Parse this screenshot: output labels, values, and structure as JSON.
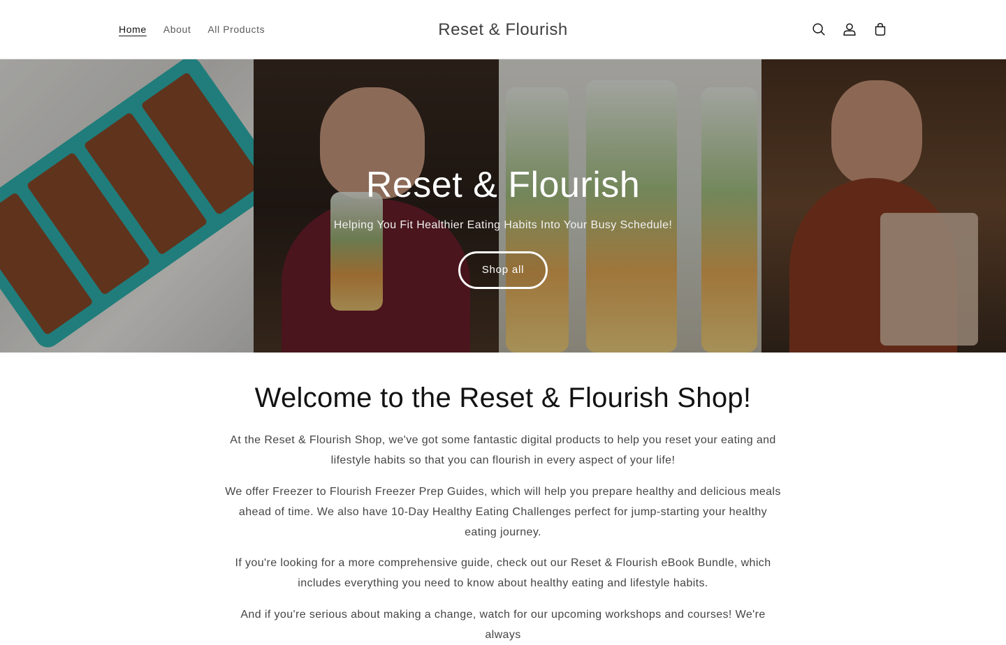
{
  "header": {
    "nav": [
      {
        "label": "Home",
        "active": true
      },
      {
        "label": "About",
        "active": false
      },
      {
        "label": "All Products",
        "active": false
      }
    ],
    "logo": "Reset & Flourish",
    "icons": [
      "search-icon",
      "account-icon",
      "cart-icon"
    ]
  },
  "hero": {
    "title": "Reset & Flourish",
    "subtitle": "Helping You Fit Healthier Eating Habits Into Your Busy Schedule!",
    "button_label": "Shop all"
  },
  "main": {
    "title": "Welcome to the Reset & Flourish Shop!",
    "paragraphs": [
      "At the Reset & Flourish Shop, we've got some fantastic digital products to help you reset your eating and lifestyle habits so that you can flourish in every aspect of your life!",
      "We offer Freezer to Flourish Freezer Prep Guides, which will help you prepare healthy and delicious meals ahead of time. We also have 10-Day Healthy Eating Challenges perfect for jump-starting your healthy eating journey.",
      "If you're looking for a more comprehensive guide, check out our Reset & Flourish eBook Bundle, which includes everything you need to know about healthy eating and lifestyle habits.",
      "And if you're serious about making a change, watch for our upcoming workshops and courses! We're always"
    ]
  },
  "colors": {
    "text": "#121212",
    "muted": "#444444",
    "tray": "#2fb3b0"
  }
}
